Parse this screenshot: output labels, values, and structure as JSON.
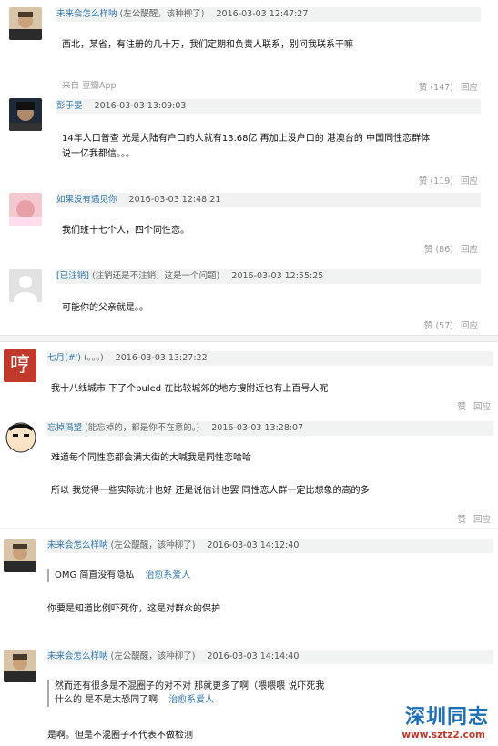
{
  "comments": [
    {
      "username": "未来会怎么样呐",
      "signature": "(左公醍醒，该种柳了)",
      "time": "2016-03-03 12:47:27",
      "lines": [
        "西北，某省，有注册的几十万，我们定期和负责人联系，别问我联系干嘛"
      ],
      "source": "来自 豆瓣App",
      "like_label": "赞",
      "like_count": "(147)",
      "reply_label": "回应"
    },
    {
      "username": "彭于晏",
      "signature": "",
      "time": "2016-03-03 13:09:03",
      "lines": [
        "14年人口普查 光是大陆有户口的人就有13.68亿 再加上没户口的 港澳台的 中国同性恋群体",
        "说一亿我都信。。。"
      ],
      "like_label": "赞",
      "like_count": "(119)",
      "reply_label": "回应"
    },
    {
      "username": "如果没有遇见你",
      "signature": "",
      "time": "2016-03-03 12:48:21",
      "lines": [
        "我们班十七个人，四个同性恋。"
      ],
      "like_label": "赞",
      "like_count": "(86)",
      "reply_label": "回应"
    },
    {
      "username": "[已注销]",
      "signature": "(注销还是不注销，这是一个问题)",
      "time": "2016-03-03 12:55:25",
      "lines": [
        "可能你的父亲就是。。"
      ],
      "like_label": "赞",
      "like_count": "(57)",
      "reply_label": "回应"
    },
    {
      "username": "七月(#')",
      "signature": "(。。。)",
      "time": "2016-03-03 13:27:22",
      "lines": [
        "我十八线城市 下了个buled 在比较城郊的地方搜附近也有上百号人呢"
      ],
      "like_label": "赞",
      "like_count": "",
      "reply_label": "回应"
    },
    {
      "username": "忘掉渴望",
      "signature": "(能忘掉的，都是你不在意的。)",
      "time": "2016-03-03 13:28:07",
      "lines": [
        "难道每个同性恋都会满大街的大喊我是同性恋哈哈",
        "所以 我觉得一些实际统计也好 还是说估计也罢 同性恋人群一定比想象的高的多"
      ],
      "like_label": "赞",
      "like_count": "",
      "reply_label": "回应"
    },
    {
      "username": "未来会怎么样呐",
      "signature": "(左公醍醒，该种柳了)",
      "time": "2016-03-03 14:12:40",
      "quote_lines": [
        "OMG 简直没有隐私"
      ],
      "quote_author": "治愈系爱人",
      "lines": [
        "你要是知道比例吓死你，这是对群众的保护"
      ]
    },
    {
      "username": "未来会怎么样呐",
      "signature": "(左公醍醒，该种柳了)",
      "time": "2016-03-03 14:14:40",
      "quote_lines": [
        "然而还有很多是不混圈子的对不对 那就更多了啊（喂喂喂 说吓死我",
        "什么的 是不是太恐同了啊"
      ],
      "quote_author": "治愈系爱人",
      "lines": [
        "是啊。但是不混圈子不代表不做检测"
      ]
    }
  ],
  "watermark": {
    "name": "深圳同志",
    "url": "www.sztz2.com"
  },
  "avatar_glyph": "哼"
}
